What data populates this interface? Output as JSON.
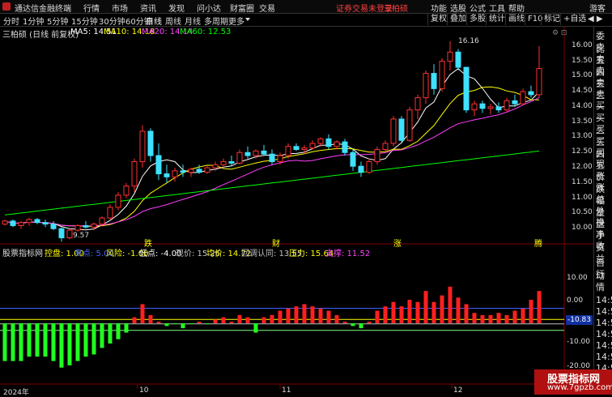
{
  "titlebar": {
    "app_name": "通达信金融终端",
    "menus": [
      "行情",
      "市场",
      "资讯",
      "发现",
      "问小达",
      "财富圈",
      "交易"
    ],
    "warning": "证券交易未登录",
    "stock_tab": "三柏硕",
    "right_menus": [
      "功能",
      "选股",
      "公式",
      "工具",
      "帮助"
    ],
    "guest": "游客"
  },
  "toolbar": {
    "periods": [
      "分时",
      "1分钟",
      "5分钟",
      "15分钟",
      "30分钟",
      "60分钟",
      "日线",
      "周线",
      "月线",
      "多周期",
      "更多"
    ],
    "active_period": "日线",
    "right_buttons": [
      "复权",
      "叠加",
      "多股",
      "统计",
      "画线",
      "F10",
      "标记",
      "+自选"
    ]
  },
  "main_chart": {
    "stock_label": "三柏硕 (日线 前复权)",
    "ma": [
      {
        "label": "MA5: 14.51",
        "color": "#ffffff"
      },
      {
        "label": "MA10: 14.18",
        "color": "#ffff00"
      },
      {
        "label": "MA20: 14.14",
        "color": "#ff40ff"
      },
      {
        "label": "MA60: 12.53",
        "color": "#00ff00"
      }
    ],
    "y_ticks": [
      "16.00",
      "15.50",
      "15.00",
      "14.50",
      "14.00",
      "13.50",
      "13.00",
      "12.50",
      "12.00",
      "11.50",
      "11.00",
      "10.50",
      "10.00"
    ],
    "high_label": "16.16",
    "low_label": "9.57",
    "markers": [
      "跌",
      "财",
      "涨",
      "腾"
    ]
  },
  "indicator": {
    "name": "股票指标网",
    "params": [
      {
        "label": "控盘: 1.00",
        "color": "#ffff00"
      },
      {
        "label": "高点: 5.00",
        "color": "#4060ff"
      },
      {
        "label": "风险: -1.00",
        "color": "#ffff00"
      },
      {
        "label": "低点: -4.00",
        "color": "#ffffff"
      },
      {
        "label": "现价: 15.26",
        "color": "#c0c0c0"
      },
      {
        "label": "均价: 14.72",
        "color": "#ffff00"
      },
      {
        "label": "回调认同: 13.55",
        "color": "#c0c0c0"
      },
      {
        "label": "压力: 15.64",
        "color": "#ffff00"
      },
      {
        "label": "支撑: 11.52",
        "color": "#ff40ff"
      }
    ],
    "y_ticks": [
      "10.00",
      "0.00",
      "-10.00",
      "-20.00"
    ],
    "cursor_value": "-10.83",
    "right_labels": [
      "14:50",
      "14:50",
      "14:50",
      "14:50",
      "14:50",
      "14:50",
      "14:50",
      "14:50",
      "14:50"
    ]
  },
  "x_axis": {
    "labels": [
      "2024年",
      "10",
      "11",
      "12"
    ]
  },
  "right_panel": {
    "items": [
      "委比",
      "卖五",
      "卖四",
      "卖三",
      "卖二",
      "卖一",
      "买一",
      "买二",
      "买三",
      "买四",
      "买五",
      "现价",
      "涨跌",
      "涨幅",
      "总量",
      "外盘",
      "换手",
      "净资",
      "收益"
    ],
    "lower": [
      "自动",
      "行情"
    ]
  },
  "watermark": {
    "title": "股票指标网",
    "url": "www.7gpzb.com"
  },
  "chart_data": {
    "type": "candlestick",
    "candles": [
      [
        10.15,
        10.3,
        10.1,
        10.25
      ],
      [
        10.25,
        10.3,
        10.05,
        10.1
      ],
      [
        10.1,
        10.25,
        10.0,
        10.2
      ],
      [
        10.2,
        10.35,
        10.1,
        10.3
      ],
      [
        10.3,
        10.35,
        10.15,
        10.2
      ],
      [
        10.2,
        10.3,
        10.05,
        10.15
      ],
      [
        10.15,
        10.25,
        9.95,
        10.0
      ],
      [
        10.0,
        10.05,
        9.57,
        9.7
      ],
      [
        9.7,
        10.0,
        9.65,
        9.95
      ],
      [
        9.95,
        10.15,
        9.9,
        10.1
      ],
      [
        10.1,
        10.25,
        10.0,
        10.05
      ],
      [
        10.05,
        10.2,
        9.95,
        10.15
      ],
      [
        10.15,
        10.4,
        10.1,
        10.35
      ],
      [
        10.35,
        10.8,
        10.3,
        10.7
      ],
      [
        10.7,
        11.2,
        10.6,
        11.1
      ],
      [
        11.1,
        11.5,
        11.0,
        11.4
      ],
      [
        11.4,
        12.3,
        11.2,
        12.2
      ],
      [
        12.2,
        13.4,
        12.0,
        13.2
      ],
      [
        13.2,
        13.3,
        12.2,
        12.4
      ],
      [
        12.4,
        12.8,
        11.6,
        11.8
      ],
      [
        11.8,
        12.1,
        11.5,
        11.7
      ],
      [
        11.7,
        12.0,
        11.55,
        11.9
      ],
      [
        11.9,
        12.1,
        11.7,
        11.85
      ],
      [
        11.85,
        12.0,
        11.7,
        11.95
      ],
      [
        11.95,
        12.1,
        11.8,
        11.85
      ],
      [
        11.85,
        12.05,
        11.8,
        12.0
      ],
      [
        12.0,
        12.2,
        11.9,
        12.1
      ],
      [
        12.1,
        12.3,
        12.0,
        12.2
      ],
      [
        12.2,
        12.4,
        12.05,
        12.15
      ],
      [
        12.15,
        12.6,
        12.1,
        12.5
      ],
      [
        12.5,
        12.7,
        12.3,
        12.4
      ],
      [
        12.4,
        12.6,
        12.3,
        12.55
      ],
      [
        12.55,
        12.75,
        12.4,
        12.45
      ],
      [
        12.45,
        12.6,
        12.1,
        12.2
      ],
      [
        12.2,
        12.5,
        12.1,
        12.4
      ],
      [
        12.4,
        12.8,
        12.3,
        12.7
      ],
      [
        12.7,
        12.8,
        12.55,
        12.6
      ],
      [
        12.6,
        12.75,
        12.45,
        12.65
      ],
      [
        12.65,
        12.9,
        12.6,
        12.8
      ],
      [
        12.8,
        13.0,
        12.7,
        12.95
      ],
      [
        12.95,
        13.1,
        12.6,
        12.7
      ],
      [
        12.7,
        12.9,
        12.6,
        12.85
      ],
      [
        12.85,
        12.95,
        12.4,
        12.5
      ],
      [
        12.5,
        12.6,
        11.9,
        12.05
      ],
      [
        12.05,
        12.2,
        11.7,
        11.85
      ],
      [
        11.85,
        12.3,
        11.8,
        12.2
      ],
      [
        12.2,
        12.7,
        12.1,
        12.6
      ],
      [
        12.6,
        12.9,
        12.5,
        12.8
      ],
      [
        12.8,
        13.7,
        12.7,
        13.6
      ],
      [
        13.6,
        13.7,
        12.8,
        12.9
      ],
      [
        12.9,
        14.0,
        12.85,
        13.9
      ],
      [
        13.9,
        14.4,
        13.6,
        14.3
      ],
      [
        14.3,
        15.2,
        14.1,
        15.1
      ],
      [
        15.1,
        15.4,
        14.4,
        14.6
      ],
      [
        14.6,
        15.6,
        14.5,
        15.5
      ],
      [
        15.5,
        16.16,
        15.2,
        15.8
      ],
      [
        15.8,
        15.9,
        15.2,
        15.3
      ],
      [
        15.3,
        14.8,
        13.8,
        13.9
      ],
      [
        13.9,
        14.2,
        13.7,
        14.1
      ],
      [
        14.1,
        14.2,
        13.8,
        13.95
      ],
      [
        13.95,
        14.1,
        13.75,
        14.0
      ],
      [
        14.0,
        14.15,
        13.8,
        13.9
      ],
      [
        13.9,
        14.3,
        13.85,
        14.2
      ],
      [
        14.2,
        14.4,
        14.0,
        14.1
      ],
      [
        14.1,
        14.6,
        14.05,
        14.5
      ],
      [
        14.5,
        14.7,
        14.3,
        14.4
      ],
      [
        14.4,
        16.0,
        14.3,
        15.26
      ]
    ],
    "indicator_values": [
      -18,
      -18,
      -18,
      -16,
      -16,
      -16,
      -18,
      -21,
      -20,
      -18,
      -16,
      -15,
      -12,
      -10,
      -8,
      -5,
      2,
      8,
      3,
      0,
      -2,
      -1,
      -3,
      -1,
      0,
      -1,
      1,
      2,
      0,
      3,
      2,
      -5,
      2,
      3,
      5,
      6,
      7,
      8,
      7,
      6,
      5,
      3,
      0,
      -2,
      -3,
      0,
      5,
      7,
      9,
      7,
      10,
      9,
      14,
      9,
      12,
      16,
      11,
      8,
      4,
      3,
      3,
      4,
      3,
      5,
      6,
      10,
      14
    ]
  }
}
